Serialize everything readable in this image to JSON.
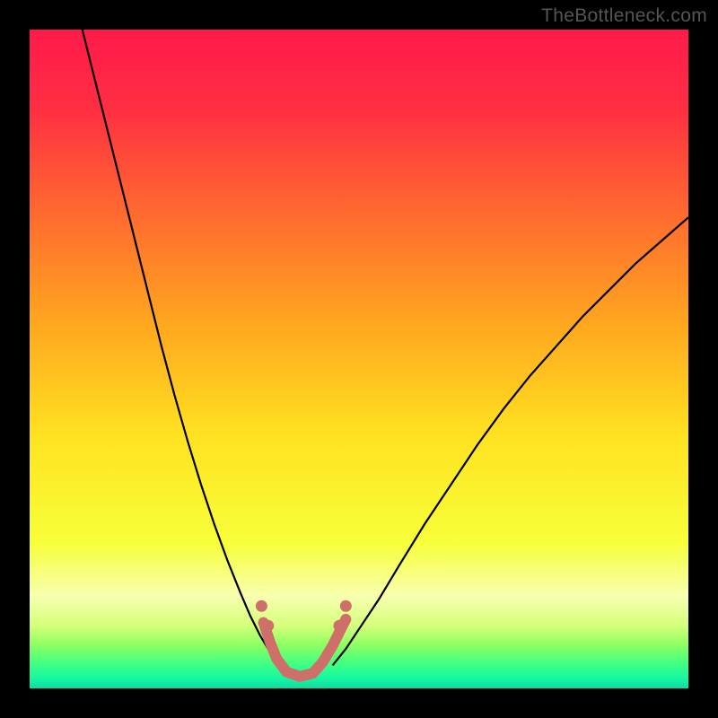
{
  "watermark": "TheBottleneck.com",
  "chart_data": {
    "type": "line",
    "title": "",
    "xlabel": "",
    "ylabel": "",
    "xlim": [
      0,
      100
    ],
    "ylim": [
      0,
      100
    ],
    "grid": false,
    "legend": false,
    "background_gradient_stops": [
      {
        "offset": 0.0,
        "color": "#ff1a4a"
      },
      {
        "offset": 0.12,
        "color": "#ff2f43"
      },
      {
        "offset": 0.28,
        "color": "#ff6a2f"
      },
      {
        "offset": 0.45,
        "color": "#ffa81f"
      },
      {
        "offset": 0.62,
        "color": "#ffe321"
      },
      {
        "offset": 0.78,
        "color": "#f7ff3a"
      },
      {
        "offset": 0.86,
        "color": "#f8ffb0"
      },
      {
        "offset": 0.905,
        "color": "#d4ff7a"
      },
      {
        "offset": 0.935,
        "color": "#8bff63"
      },
      {
        "offset": 0.965,
        "color": "#3bff86"
      },
      {
        "offset": 0.985,
        "color": "#15f7a3"
      },
      {
        "offset": 1.0,
        "color": "#0fd9a0"
      }
    ],
    "series": [
      {
        "name": "left-curve",
        "stroke": "#000000",
        "stroke_width": 2.2,
        "x": [
          8,
          10,
          12,
          14,
          16,
          18,
          20,
          22,
          24,
          26,
          28,
          30,
          32,
          33.5,
          35,
          36.5,
          38
        ],
        "y": [
          100,
          92,
          84,
          76,
          68,
          60,
          52,
          44.5,
          37.5,
          31,
          25,
          19.5,
          14.5,
          11,
          8,
          5.5,
          3.5
        ]
      },
      {
        "name": "right-curve",
        "stroke": "#000000",
        "stroke_width": 2.2,
        "x": [
          46,
          48,
          50,
          53,
          56,
          60,
          64,
          68,
          72,
          76,
          80,
          84,
          88,
          92,
          96,
          100
        ],
        "y": [
          3.5,
          6,
          9,
          13.5,
          18.5,
          25,
          31,
          37,
          42.5,
          47.5,
          52,
          56.5,
          60.5,
          64.5,
          68,
          71.5
        ]
      },
      {
        "name": "trough-segment",
        "stroke": "#cf6f6a",
        "stroke_width": 12,
        "linecap": "round",
        "x": [
          35.5,
          36.5,
          37.5,
          39,
          41,
          43,
          44.5,
          46,
          47,
          48
        ],
        "y": [
          10,
          7,
          4.5,
          2.5,
          1.8,
          2.3,
          4,
          6.5,
          8.5,
          10.5
        ]
      }
    ],
    "trough_dots": {
      "fill": "#cf6f6a",
      "radius": 6.5,
      "points": [
        {
          "x": 35.2,
          "y": 12.5
        },
        {
          "x": 36.2,
          "y": 9.5
        },
        {
          "x": 47.0,
          "y": 9.5
        },
        {
          "x": 48.0,
          "y": 12.5
        }
      ]
    }
  }
}
